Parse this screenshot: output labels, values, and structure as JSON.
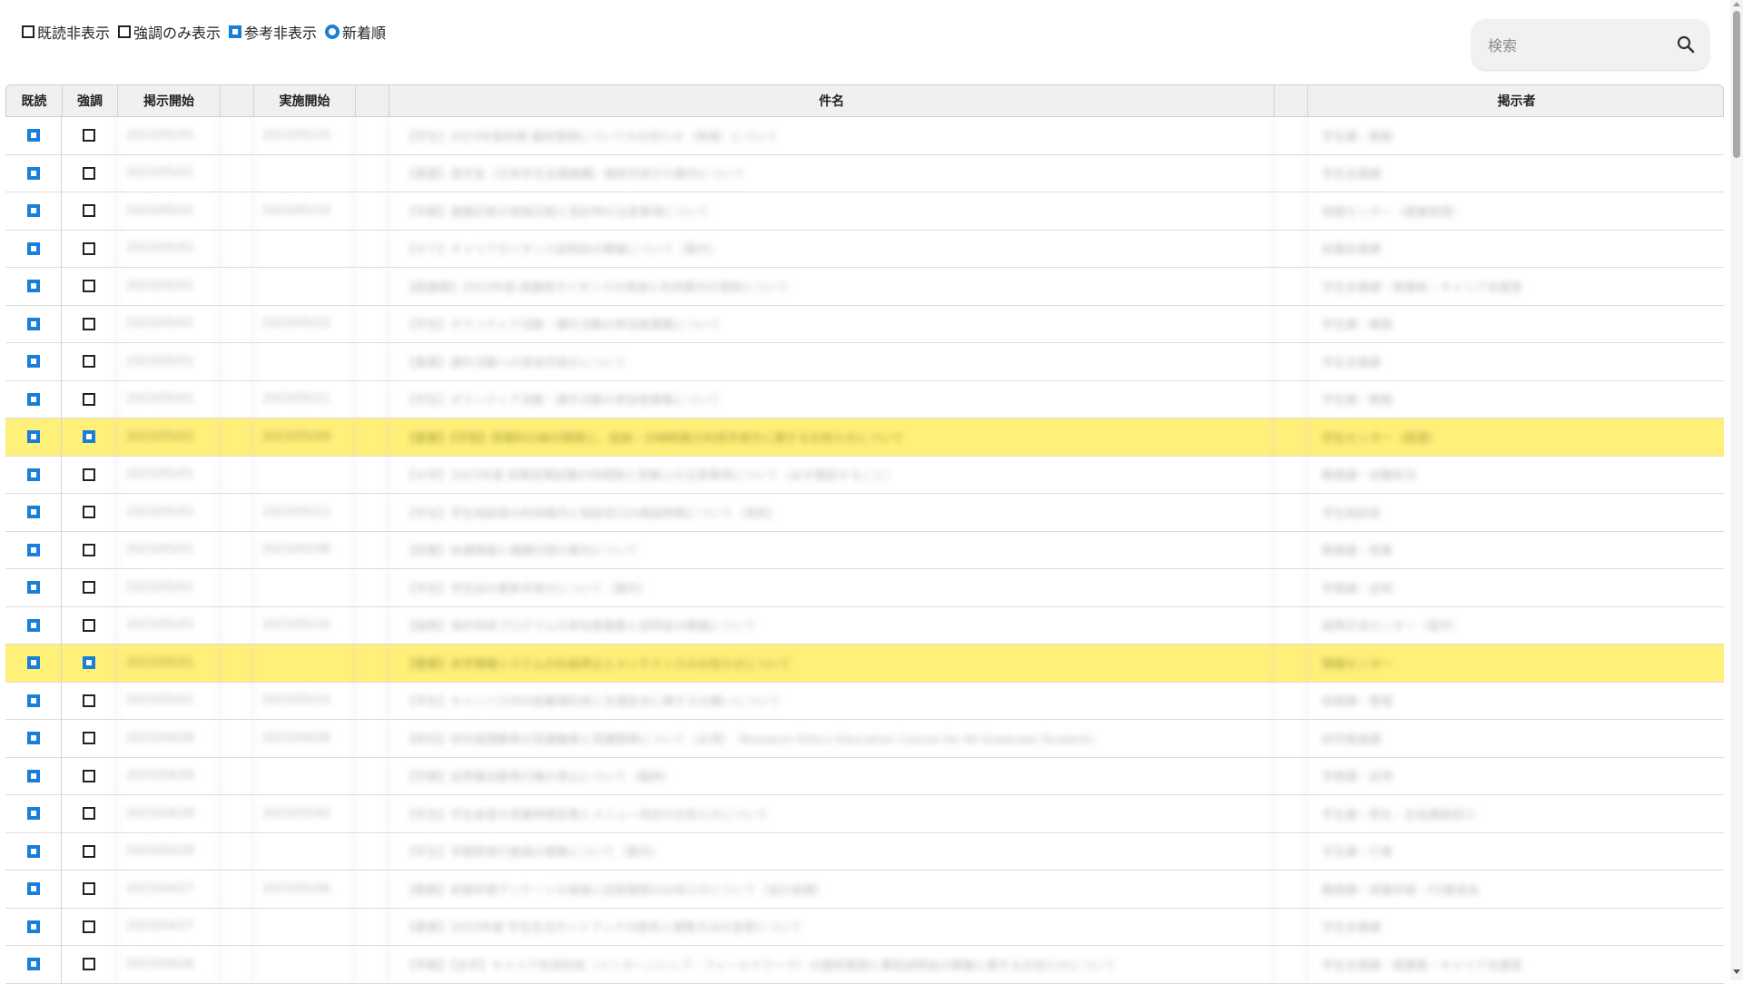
{
  "filters": {
    "hide_read": {
      "label": "既読非表示",
      "checked": false
    },
    "emphasis_only": {
      "label": "強調のみ表示",
      "checked": false
    },
    "hide_reference": {
      "label": "参考非表示",
      "checked": true
    },
    "newest_first": {
      "label": "新着順",
      "selected": true
    }
  },
  "search": {
    "placeholder": "検索",
    "icon": "search-icon"
  },
  "columns": {
    "read": "既読",
    "emphasis": "強調",
    "post_start": "掲示開始",
    "impl_start": "実施開始",
    "subject": "件名",
    "poster": "掲示者"
  },
  "colors": {
    "checkbox_on": "#1a7fd8",
    "highlight": "#fff07a"
  },
  "rows": [
    {
      "read": true,
      "emphasis": false,
      "post_start": "2023/05/01",
      "impl_start": "2023/05/15",
      "subject": "【学生】2023年度前期 履修登録についてのお知らせ（再掲）について",
      "poster": "学生課・教務"
    },
    {
      "read": true,
      "emphasis": false,
      "post_start": "2023/05/01",
      "impl_start": "",
      "subject": "【重要】奨学金（日本学生支援機構）継続手続きの案内について",
      "poster": "学生支援課"
    },
    {
      "read": true,
      "emphasis": false,
      "post_start": "2023/05/01",
      "impl_start": "2023/05/10",
      "subject": "【学務】健康診断の実施日程と受診時の注意事項について",
      "poster": "保健センター（健康管理）"
    },
    {
      "read": true,
      "emphasis": false,
      "post_start": "2023/05/01",
      "impl_start": "",
      "subject": "【ゼミ】キャリアガイダンス説明会の開催について（案内）",
      "poster": "就職支援課"
    },
    {
      "read": true,
      "emphasis": false,
      "post_start": "2023/05/01",
      "impl_start": "",
      "subject": "【図書館】2023年度 図書館ガイダンスの実施と利用案内の更新について",
      "poster": "学生支援課・図書館・キャリア支援室"
    },
    {
      "read": true,
      "emphasis": false,
      "post_start": "2023/05/01",
      "impl_start": "2023/05/22",
      "subject": "【学生】ボランティア活動・課外活動の参加者募集について",
      "poster": "学生課・教務"
    },
    {
      "read": true,
      "emphasis": false,
      "post_start": "2023/05/01",
      "impl_start": "",
      "subject": "【重要】課外活動への参加手続きについて",
      "poster": "学生支援課"
    },
    {
      "read": true,
      "emphasis": false,
      "post_start": "2023/05/01",
      "impl_start": "2023/05/21",
      "subject": "【学生】ボランティア活動・課外活動の参加者募集について",
      "poster": "学生課・教務"
    },
    {
      "read": true,
      "emphasis": true,
      "post_start": "2023/05/01",
      "impl_start": "2023/05/09",
      "subject": "【重要】【学部】授業料の納付期限と、延納・分納制度の利用手続きに関するお知らせについて",
      "poster": "学生センター（経理）",
      "highlight": true
    },
    {
      "read": true,
      "emphasis": false,
      "post_start": "2023/05/01",
      "impl_start": "",
      "subject": "【大学】2023年度 前期定期試験の時間割と受験上の注意事項について（必ず確認すること）",
      "poster": "教務課・試験担当"
    },
    {
      "read": true,
      "emphasis": false,
      "post_start": "2023/05/01",
      "impl_start": "2023/05/12",
      "subject": "【学生】学生相談室の利用案内と相談窓口の開設時間について（周知）",
      "poster": "学生相談室"
    },
    {
      "read": true,
      "emphasis": false,
      "post_start": "2023/05/01",
      "impl_start": "2023/05/08",
      "subject": "【授業】休講情報と補講日程の案内について",
      "poster": "教務課・授業"
    },
    {
      "read": true,
      "emphasis": false,
      "post_start": "2023/05/01",
      "impl_start": "",
      "subject": "【学生】学生証の更新手続きについて（案内）",
      "poster": "学務課・証明"
    },
    {
      "read": true,
      "emphasis": false,
      "post_start": "2023/05/01",
      "impl_start": "2023/05/16",
      "subject": "【国際】海外研修プログラムの参加者募集と説明会の開催について",
      "poster": "国際交流センター（留学）"
    },
    {
      "read": true,
      "emphasis": true,
      "post_start": "2023/05/01",
      "impl_start": "",
      "subject": "【重要】本学情報システムの計画停止とメンテナンスのお知らせについて",
      "poster": "情報センター",
      "highlight": true
    },
    {
      "read": true,
      "emphasis": false,
      "post_start": "2023/05/01",
      "impl_start": "2023/05/14",
      "subject": "【学生】キャンパス内の駐輪場利用と交通安全に関するお願いについて",
      "poster": "総務課・管理"
    },
    {
      "read": true,
      "emphasis": false,
      "post_start": "2023/04/28",
      "impl_start": "2023/04/28",
      "subject": "【研究】研究倫理教育の受講義務と受講期限について（必須）　Research Ethics Education Course for All Graduate Students",
      "poster": "研究推進課"
    },
    {
      "read": true,
      "emphasis": false,
      "post_start": "2023/04/28",
      "impl_start": "",
      "subject": "【学務】証明書自動発行機の停止について（臨時）",
      "poster": "学務課・証明"
    },
    {
      "read": true,
      "emphasis": false,
      "post_start": "2023/04/28",
      "impl_start": "2023/05/02",
      "subject": "【学生】学生食堂の営業時間変更とメニュー改定のお知らせについて",
      "poster": "学生課・厚生・生協連絡窓口"
    },
    {
      "read": true,
      "emphasis": false,
      "post_start": "2023/04/28",
      "impl_start": "",
      "subject": "【学生】学園祭実行委員の募集について（案内）",
      "poster": "学生課・行事"
    },
    {
      "read": true,
      "emphasis": false,
      "post_start": "2023/04/27",
      "impl_start": "2023/05/06",
      "subject": "【教務】前期中間アンケートの実施と回答期限のお知らせについて（協力依頼）",
      "poster": "教務課・授業評価・FD委員会"
    },
    {
      "read": true,
      "emphasis": false,
      "post_start": "2023/04/27",
      "impl_start": "",
      "subject": "【重要】2023年度 学生生活ガイドブックの配布と閲覧方法の変更について",
      "poster": "学生支援課"
    },
    {
      "read": true,
      "emphasis": false,
      "post_start": "2023/04/26",
      "impl_start": "",
      "subject": "【学務】【全学】キャリア形成科目（インターンシップ・フィールドワーク）の履修登録と事前説明会の開催に関するお知らせについて",
      "poster": "学生支援課・図書館・キャリア支援室"
    }
  ]
}
